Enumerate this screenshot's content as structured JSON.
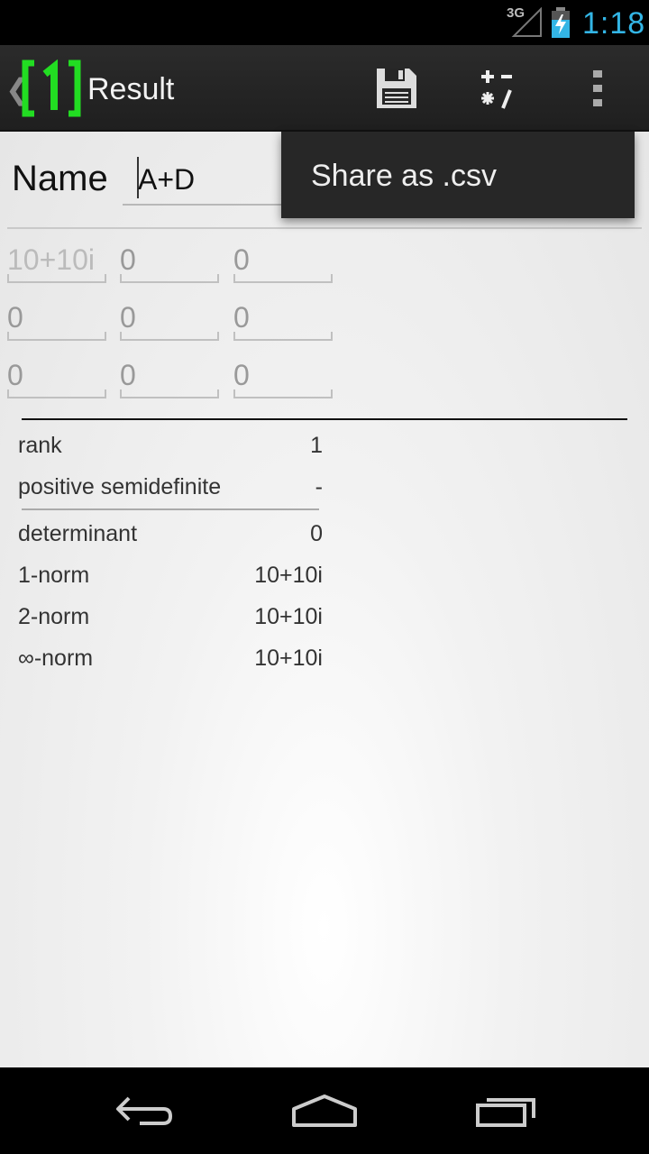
{
  "status_bar": {
    "network": "3G",
    "time": "1:18"
  },
  "action_bar": {
    "up_caret": "❮",
    "logo_text": "1",
    "title": "Result",
    "save_icon": "floppy-disk-icon",
    "ops_icon": "arithmetic-operators-icon",
    "overflow_icon": "overflow-menu-icon"
  },
  "name_row": {
    "label": "Name",
    "value": "A+D"
  },
  "matrix": [
    [
      "10+10i",
      "0",
      "0"
    ],
    [
      "0",
      "0",
      "0"
    ],
    [
      "0",
      "0",
      "0"
    ]
  ],
  "properties": [
    {
      "key": "rank",
      "value": "1"
    },
    {
      "key": "positive semidefinite",
      "value": "-"
    },
    {
      "key": "determinant",
      "value": "0"
    },
    {
      "key": "1-norm",
      "value": "10+10i"
    },
    {
      "key": "2-norm",
      "value": "10+10i"
    },
    {
      "key": "∞-norm",
      "value": "10+10i"
    }
  ],
  "popup_menu": {
    "items": [
      "Share as .csv"
    ]
  },
  "colors": {
    "accent": "#33b5e5",
    "logo_green": "#22dd22",
    "action_bar": "#262626",
    "popup": "#272727"
  }
}
